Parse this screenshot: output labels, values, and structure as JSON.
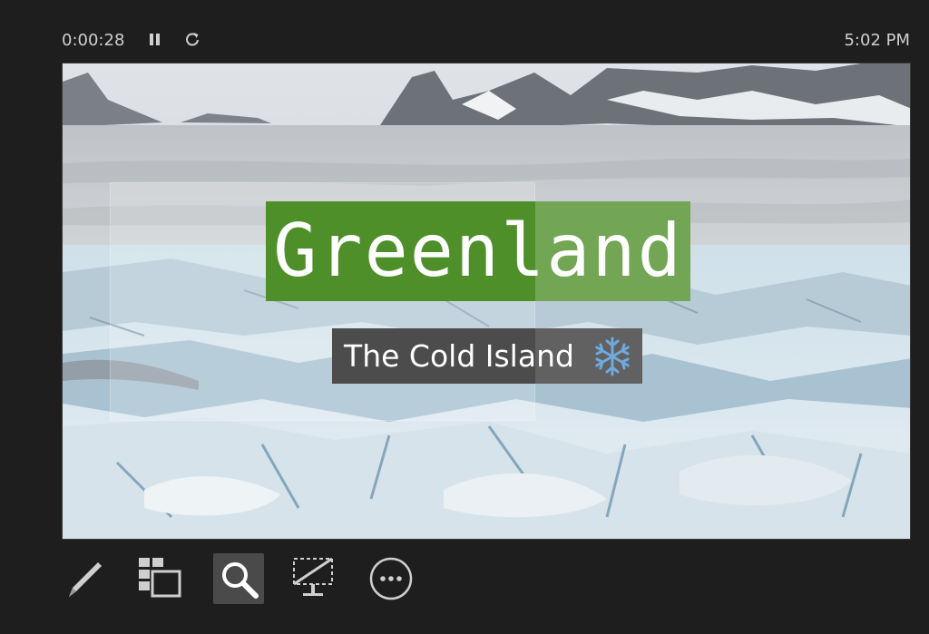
{
  "topbar": {
    "elapsed_time": "0:00:28",
    "clock": "5:02 PM",
    "pause_icon": "pause-icon",
    "restart_icon": "restart-icon"
  },
  "slide": {
    "title": "Greenland",
    "subtitle": "The Cold Island",
    "subtitle_icon": "snowflake-icon",
    "background": "glacier-photo",
    "colors": {
      "title_bg": "#4f8f2a",
      "subtitle_bg": "#4c4c4c",
      "text": "#ffffff",
      "snowflake": "#6fa9de"
    }
  },
  "toolbar": {
    "items": [
      {
        "icon": "pen-icon"
      },
      {
        "icon": "see-all-slides-icon"
      },
      {
        "icon": "zoom-icon",
        "active": true
      },
      {
        "icon": "black-screen-icon"
      },
      {
        "icon": "more-options-icon"
      }
    ]
  }
}
